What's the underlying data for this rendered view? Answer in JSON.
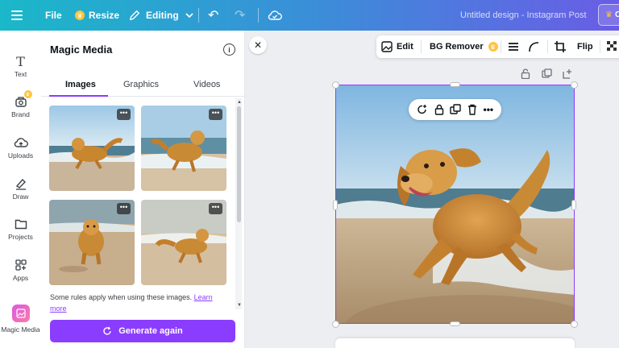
{
  "topbar": {
    "file_label": "File",
    "resize_label": "Resize",
    "editing_label": "Editing",
    "doc_title": "Untitled design - Instagram Post",
    "share_label": "C"
  },
  "rail": {
    "items": [
      {
        "label": "Text",
        "icon": "text-icon"
      },
      {
        "label": "Brand",
        "icon": "brand-icon"
      },
      {
        "label": "Uploads",
        "icon": "uploads-icon"
      },
      {
        "label": "Draw",
        "icon": "draw-icon"
      },
      {
        "label": "Projects",
        "icon": "folder-icon"
      },
      {
        "label": "Apps",
        "icon": "apps-icon"
      },
      {
        "label": "Magic Media",
        "icon": "magic-media-icon"
      }
    ]
  },
  "panel": {
    "title": "Magic Media",
    "tabs": [
      "Images",
      "Graphics",
      "Videos"
    ],
    "active_tab": "Images",
    "rules_text": "Some rules apply when using these images.",
    "learn_more": "Learn more",
    "generate_label": "Generate again"
  },
  "canvas": {
    "toolbar": {
      "edit_label": "Edit",
      "bg_remover_label": "BG Remover",
      "flip_label": "Flip"
    }
  },
  "colors": {
    "accent": "#8b3dff",
    "topbar_start": "#1ab8c9",
    "topbar_end": "#6a5ce6",
    "crown": "#ffc43d"
  }
}
